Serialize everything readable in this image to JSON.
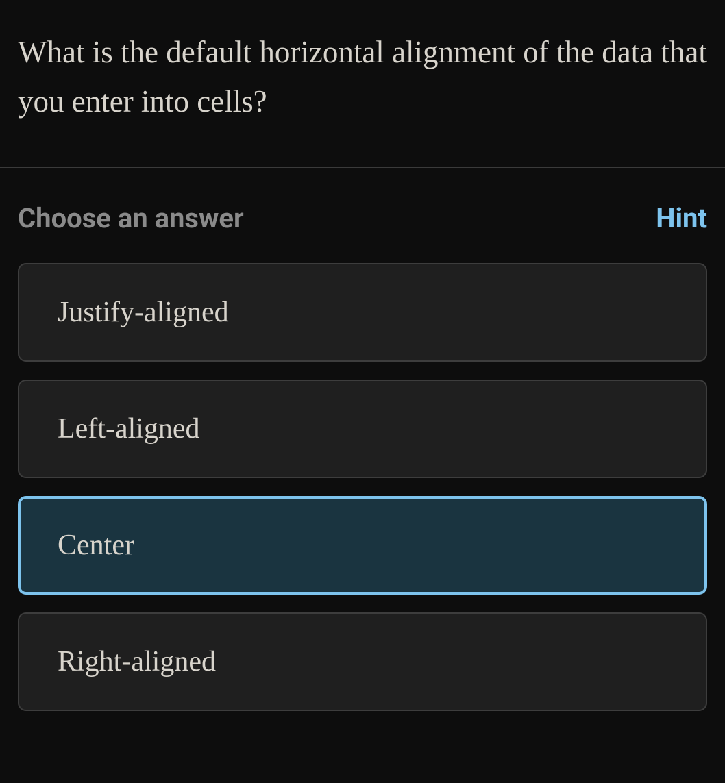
{
  "question": {
    "text": "What is the default horizontal alignment of the data that you enter into cells?"
  },
  "answerSection": {
    "chooseLabel": "Choose an answer",
    "hintLabel": "Hint",
    "options": [
      {
        "text": "Justify-aligned",
        "selected": false
      },
      {
        "text": "Left-aligned",
        "selected": false
      },
      {
        "text": "Center",
        "selected": true
      },
      {
        "text": "Right-aligned",
        "selected": false
      }
    ]
  }
}
